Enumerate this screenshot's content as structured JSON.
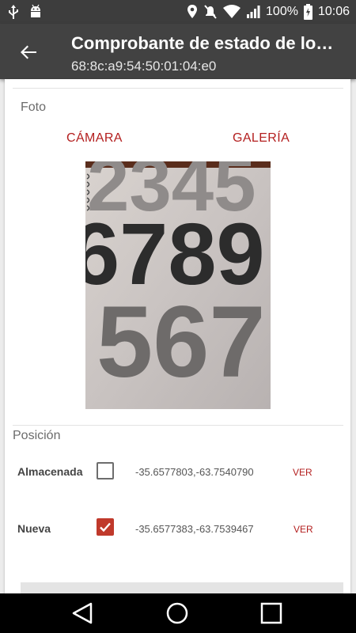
{
  "status_bar": {
    "battery": "100%",
    "time": "10:06",
    "icons": [
      "usb-icon",
      "android-icon",
      "location-icon",
      "mute-icon",
      "wifi-icon",
      "signal-icon",
      "battery-icon"
    ]
  },
  "app_bar": {
    "title": "Comprobante de estado de lo…",
    "subtitle": "68:8c:a9:54:50:01:04:e0",
    "back_icon": "arrow-back-icon"
  },
  "photo_section": {
    "label": "Foto",
    "camera_button": "CÁMARA",
    "gallery_button": "GALERÍA",
    "photo_digits_row1": "2345",
    "photo_digits_row2": "6789",
    "photo_digits_row3": "567"
  },
  "position_section": {
    "label": "Posición",
    "rows": [
      {
        "label": "Almacenada",
        "checked": false,
        "coords": "-35.6577803,-63.7540790",
        "action": "VER"
      },
      {
        "label": "Nueva",
        "checked": true,
        "coords": "-35.6577383,-63.7539467",
        "action": "VER"
      }
    ]
  },
  "nav_bar": {
    "icons": [
      "back-triangle-icon",
      "home-circle-icon",
      "recents-square-icon"
    ]
  },
  "colors": {
    "accent": "#b31e1e",
    "checkbox_checked": "#c0392b",
    "app_bar": "#424242",
    "status_bar": "#3d3d3d"
  }
}
